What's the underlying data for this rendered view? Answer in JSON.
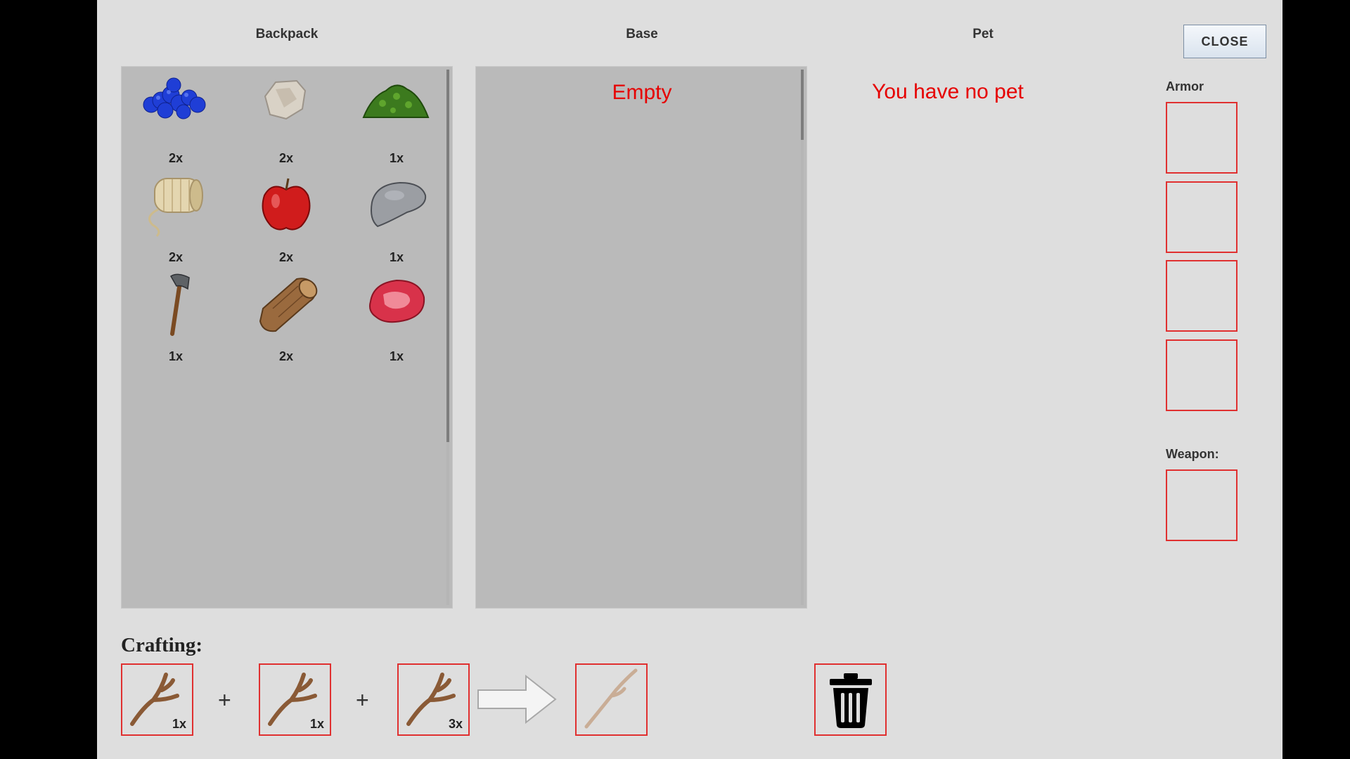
{
  "columns": {
    "backpack": "Backpack",
    "base": "Base",
    "pet": "Pet"
  },
  "close_label": "CLOSE",
  "backpack_items": [
    {
      "icon": "blueberries-icon",
      "qty": "2x"
    },
    {
      "icon": "flint-stone-icon",
      "qty": "2x"
    },
    {
      "icon": "leaves-icon",
      "qty": "1x"
    },
    {
      "icon": "rope-spool-icon",
      "qty": "2x"
    },
    {
      "icon": "apple-icon",
      "qty": "2x"
    },
    {
      "icon": "stone-icon",
      "qty": "1x"
    },
    {
      "icon": "axe-icon",
      "qty": "1x"
    },
    {
      "icon": "wood-log-icon",
      "qty": "2x"
    },
    {
      "icon": "raw-meat-icon",
      "qty": "1x"
    }
  ],
  "base_message": "Empty",
  "pet_message": "You have no pet",
  "armor_label": "Armor",
  "weapon_label": "Weapon:",
  "crafting": {
    "title": "Crafting:",
    "ingredients": [
      {
        "icon": "twig-icon",
        "qty": "1x"
      },
      {
        "icon": "twig-icon",
        "qty": "1x"
      },
      {
        "icon": "twig-icon",
        "qty": "3x"
      }
    ],
    "plus": "+",
    "result_icon": "stick-icon",
    "trash_icon": "trash-icon"
  },
  "colors": {
    "accent_red": "#e03030",
    "panel_gray": "#bababa",
    "window_bg": "#dedede"
  }
}
